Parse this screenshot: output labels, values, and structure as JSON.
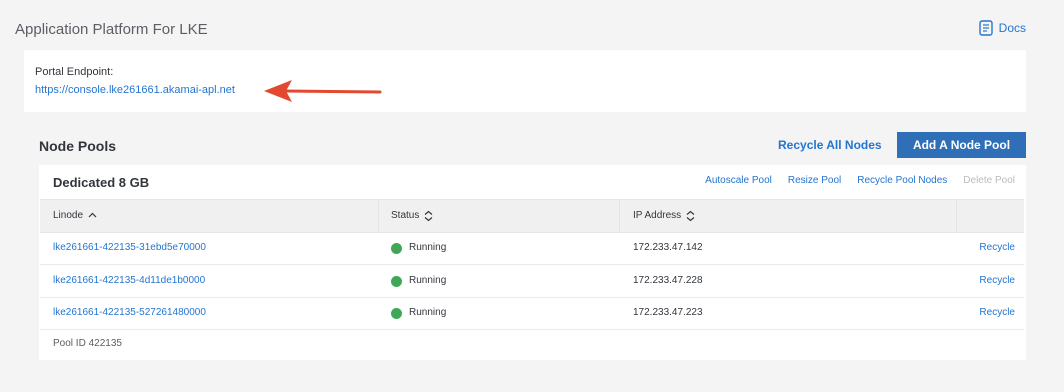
{
  "app_platform": {
    "title": "Application Platform For LKE",
    "docs_label": "Docs",
    "endpoint_label": "Portal Endpoint:",
    "endpoint_url": "https://console.lke261661.akamai-apl.net",
    "annotation_arrow_color": "#e2492f"
  },
  "node_pools": {
    "title": "Node Pools",
    "recycle_all_label": "Recycle All Nodes",
    "add_pool_label": "Add A Node Pool",
    "pools": [
      {
        "name": "Dedicated 8 GB",
        "actions": {
          "autoscale": "Autoscale Pool",
          "resize": "Resize Pool",
          "recycle_pool": "Recycle Pool Nodes",
          "delete": "Delete Pool"
        },
        "columns": [
          "Linode",
          "Status",
          "IP Address"
        ],
        "rows": [
          {
            "linode": "lke261661-422135-31ebd5e70000",
            "status": "Running",
            "ip": "172.233.47.142",
            "action": "Recycle"
          },
          {
            "linode": "lke261661-422135-4d11de1b0000",
            "status": "Running",
            "ip": "172.233.47.228",
            "action": "Recycle"
          },
          {
            "linode": "lke261661-422135-527261480000",
            "status": "Running",
            "ip": "172.233.47.223",
            "action": "Recycle"
          }
        ],
        "pool_id_text": "Pool ID 422135"
      }
    ]
  },
  "colors": {
    "link": "#2575d0",
    "primary_button": "#2e6fb8",
    "status_running": "#3fa857"
  }
}
